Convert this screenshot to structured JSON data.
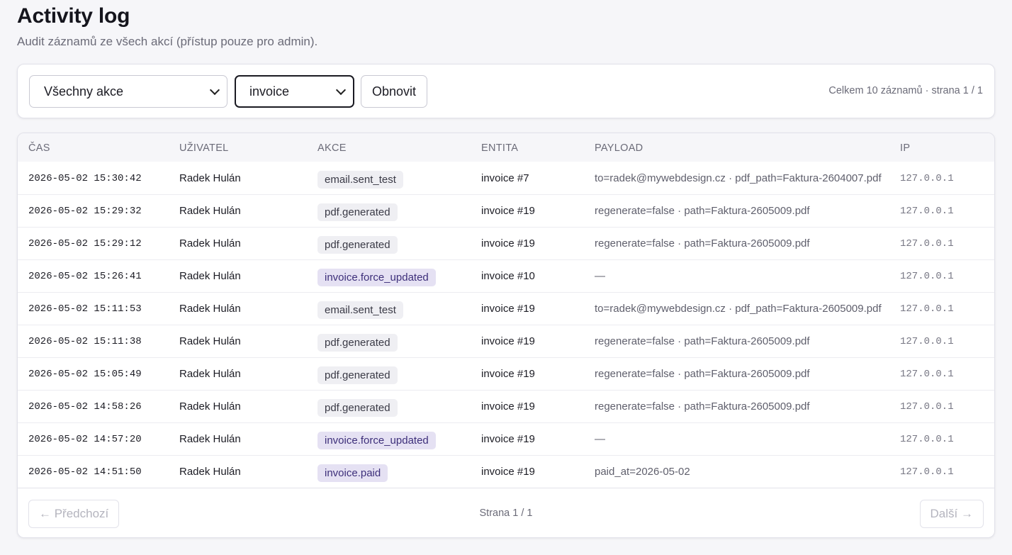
{
  "header": {
    "title": "Activity log",
    "subtitle": "Audit záznamů ze všech akcí (přístup pouze pro admin)."
  },
  "filters": {
    "action_select": "Všechny akce",
    "entity_select": "invoice",
    "refresh_label": "Obnovit",
    "summary": "Celkem 10 záznamů · strana 1 / 1"
  },
  "table": {
    "columns": {
      "time": "ČAS",
      "user": "UŽIVATEL",
      "action": "AKCE",
      "entity": "ENTITA",
      "payload": "PAYLOAD",
      "ip": "IP"
    },
    "rows": [
      {
        "time": "2026-05-02 15:30:42",
        "user": "Radek Hulán",
        "action": "email.sent_test",
        "entity": "invoice #7",
        "payload": "to=radek@mywebdesign.cz · pdf_path=Faktura-2604007.pdf",
        "ip": "127.0.0.1"
      },
      {
        "time": "2026-05-02 15:29:32",
        "user": "Radek Hulán",
        "action": "pdf.generated",
        "entity": "invoice #19",
        "payload": "regenerate=false · path=Faktura-2605009.pdf",
        "ip": "127.0.0.1"
      },
      {
        "time": "2026-05-02 15:29:12",
        "user": "Radek Hulán",
        "action": "pdf.generated",
        "entity": "invoice #19",
        "payload": "regenerate=false · path=Faktura-2605009.pdf",
        "ip": "127.0.0.1"
      },
      {
        "time": "2026-05-02 15:26:41",
        "user": "Radek Hulán",
        "action": "invoice.force_updated",
        "entity": "invoice #10",
        "payload": "—",
        "ip": "127.0.0.1"
      },
      {
        "time": "2026-05-02 15:11:53",
        "user": "Radek Hulán",
        "action": "email.sent_test",
        "entity": "invoice #19",
        "payload": "to=radek@mywebdesign.cz · pdf_path=Faktura-2605009.pdf",
        "ip": "127.0.0.1"
      },
      {
        "time": "2026-05-02 15:11:38",
        "user": "Radek Hulán",
        "action": "pdf.generated",
        "entity": "invoice #19",
        "payload": "regenerate=false · path=Faktura-2605009.pdf",
        "ip": "127.0.0.1"
      },
      {
        "time": "2026-05-02 15:05:49",
        "user": "Radek Hulán",
        "action": "pdf.generated",
        "entity": "invoice #19",
        "payload": "regenerate=false · path=Faktura-2605009.pdf",
        "ip": "127.0.0.1"
      },
      {
        "time": "2026-05-02 14:58:26",
        "user": "Radek Hulán",
        "action": "pdf.generated",
        "entity": "invoice #19",
        "payload": "regenerate=false · path=Faktura-2605009.pdf",
        "ip": "127.0.0.1"
      },
      {
        "time": "2026-05-02 14:57:20",
        "user": "Radek Hulán",
        "action": "invoice.force_updated",
        "entity": "invoice #19",
        "payload": "—",
        "ip": "127.0.0.1"
      },
      {
        "time": "2026-05-02 14:51:50",
        "user": "Radek Hulán",
        "action": "invoice.paid",
        "entity": "invoice #19",
        "payload": "paid_at=2026-05-02",
        "ip": "127.0.0.1"
      }
    ]
  },
  "pagination": {
    "prev_label": "← Předchozí",
    "page_info": "Strana 1 / 1",
    "next_label": "Další →"
  },
  "colors": {
    "background": "#f6f6f9",
    "badge_neutral": "#efeff3",
    "badge_accent": "#e5e1f3",
    "badge_accent_text": "#3d2f7a"
  }
}
